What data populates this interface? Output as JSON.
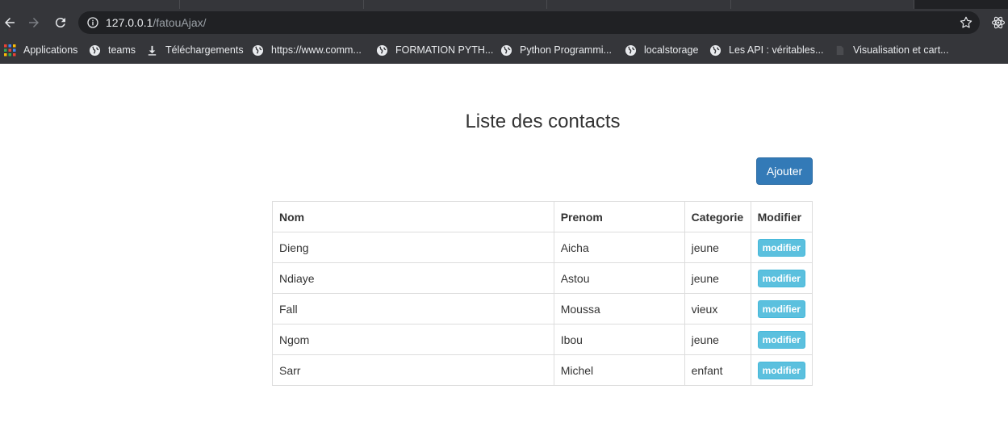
{
  "browser": {
    "url_host": "127.0.0.1",
    "url_path": "/fatouAjax/"
  },
  "bookmarks": [
    {
      "label": "Applications",
      "icon": "apps-grid-icon"
    },
    {
      "label": "teams",
      "icon": "globe-icon"
    },
    {
      "label": "Téléchargements",
      "icon": "download-icon"
    },
    {
      "label": "https://www.comm...",
      "icon": "globe-icon"
    },
    {
      "label": "FORMATION PYTH...",
      "icon": "globe-icon"
    },
    {
      "label": "Python Programmi...",
      "icon": "globe-icon"
    },
    {
      "label": "localstorage",
      "icon": "globe-icon"
    },
    {
      "label": "Les API : véritables...",
      "icon": "globe-icon"
    },
    {
      "label": "Visualisation et cart...",
      "icon": "page-icon"
    }
  ],
  "page": {
    "title": "Liste des contacts",
    "add_button": "Ajouter"
  },
  "table": {
    "headers": [
      "Nom",
      "Prenom",
      "Categorie",
      "Modifier"
    ],
    "rows": [
      {
        "nom": "Dieng",
        "prenom": "Aicha",
        "categorie": "jeune",
        "action": "modifier"
      },
      {
        "nom": "Ndiaye",
        "prenom": "Astou",
        "categorie": "jeune",
        "action": "modifier"
      },
      {
        "nom": "Fall",
        "prenom": "Moussa",
        "categorie": "vieux",
        "action": "modifier"
      },
      {
        "nom": "Ngom",
        "prenom": "Ibou",
        "categorie": "jeune",
        "action": "modifier"
      },
      {
        "nom": "Sarr",
        "prenom": "Michel",
        "categorie": "enfant",
        "action": "modifier"
      }
    ]
  },
  "colors": {
    "primary": "#337ab7",
    "info": "#5bc0de",
    "chrome_bg": "#35363a"
  }
}
